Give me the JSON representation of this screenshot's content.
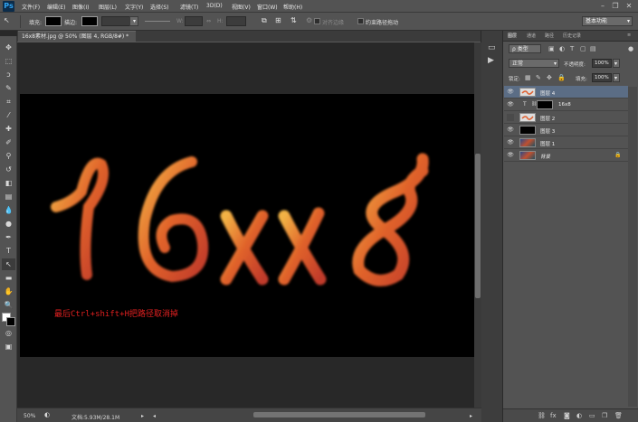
{
  "app": {
    "logo": "Ps"
  },
  "menu": [
    "文件(F)",
    "编辑(E)",
    "图像(I)",
    "图层(L)",
    "文字(Y)",
    "选择(S)",
    "滤镜(T)",
    "3D(D)",
    "视图(V)",
    "窗口(W)",
    "帮助(H)"
  ],
  "options": {
    "fill_label": "填充:",
    "stroke_label": "描边:",
    "w_label": "W:",
    "h_label": "H:",
    "align_edges": "对齐边缘",
    "constrain_path": "约束路径拖动",
    "workspace": "基本功能"
  },
  "document": {
    "tab_title": "16x8素材.jpg @ 50% (图层 4, RGB/8#) *",
    "artwork_text": "16xx8",
    "caption": "最后Ctrl+shift+H把路径取消掉"
  },
  "status": {
    "zoom": "50%",
    "doc_size": "文档:5.93M/28.1M"
  },
  "panels": {
    "tabs": [
      "图层",
      "通道",
      "路径",
      "历史记录"
    ],
    "kind_filter": "ρ 类型",
    "blend_mode": "正常",
    "opacity_label": "不透明度:",
    "opacity_value": "100%",
    "lock_label": "锁定:",
    "fill_label": "填充:",
    "fill_value": "100%"
  },
  "layers": [
    {
      "name": "图层 4",
      "active": true,
      "visible": true,
      "thumb": "text-art"
    },
    {
      "name": "16x8",
      "active": false,
      "visible": true,
      "thumb": "type"
    },
    {
      "name": "图层 2",
      "active": false,
      "visible": false,
      "thumb": "text-art"
    },
    {
      "name": "图层 3",
      "active": false,
      "visible": true,
      "thumb": "black"
    },
    {
      "name": "图层 1",
      "active": false,
      "visible": true,
      "thumb": "image"
    },
    {
      "name": "背景",
      "active": false,
      "visible": true,
      "thumb": "image",
      "locked": true
    }
  ],
  "colors": {
    "accent": "#5b6d85",
    "caption": "#e02020",
    "panel": "#535353"
  }
}
